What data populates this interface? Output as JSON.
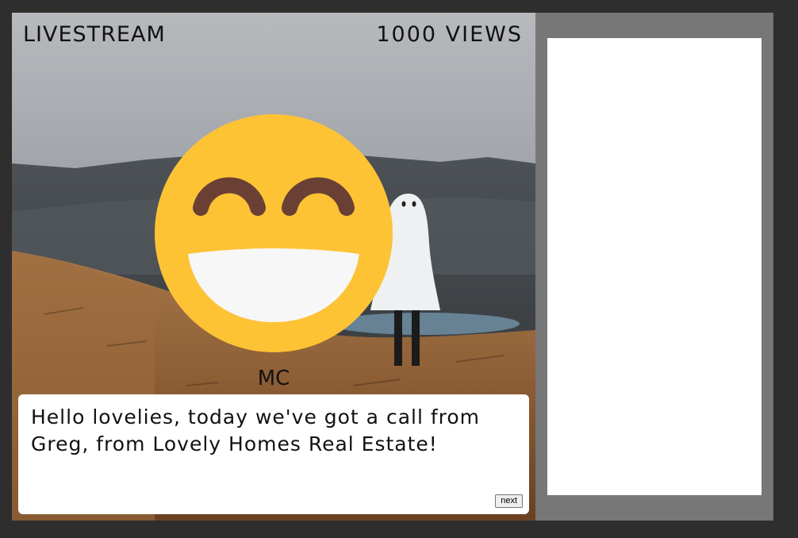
{
  "hud": {
    "mode_label": "LIVESTREAM",
    "views_label": "1000 VIEWS"
  },
  "speaker": {
    "name": "MC"
  },
  "dialog": {
    "text": "Hello lovelies, today we've got a call from Greg, from Lovely Homes Real Estate!",
    "next_label": "next"
  },
  "colors": {
    "page_bg": "#2e2e2e",
    "side_panel": "#777777",
    "emoji_face": "#fdc335",
    "emoji_features": "#6b4034",
    "emoji_mouth": "#f7f7f7"
  },
  "icons": {
    "avatar": "grinning-smiley-emoji",
    "background": "ghost-on-hillside-photo"
  }
}
